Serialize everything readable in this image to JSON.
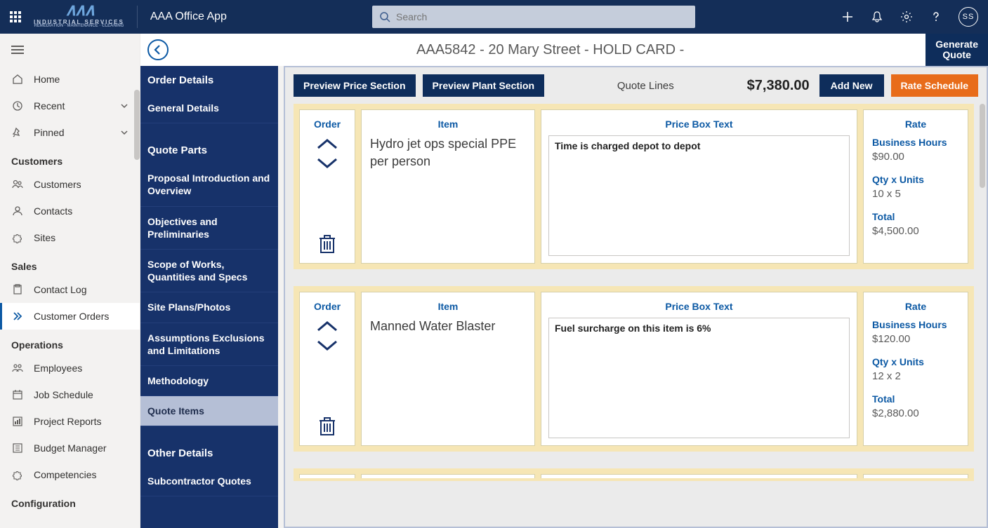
{
  "topbar": {
    "logo_main": "AAA",
    "logo_line1": "INDUSTRIAL SERVICES",
    "logo_line2": "REMEDIATION · MAINTENANCE · CLEANING",
    "app_name": "AAA Office App",
    "search_placeholder": "Search",
    "avatar_initials": "SS"
  },
  "breadbar": {
    "title": "AAA5842 - 20 Mary Street - HOLD CARD -",
    "generate_btn_l1": "Generate",
    "generate_btn_l2": "Quote"
  },
  "leftnav": {
    "home": "Home",
    "recent": "Recent",
    "pinned": "Pinned",
    "sections": {
      "customers": "Customers",
      "sales": "Sales",
      "operations": "Operations",
      "configuration": "Configuration"
    },
    "items": {
      "customers": "Customers",
      "contacts": "Contacts",
      "sites": "Sites",
      "contact_log": "Contact Log",
      "customer_orders": "Customer Orders",
      "employees": "Employees",
      "job_schedule": "Job Schedule",
      "project_reports": "Project Reports",
      "budget_manager": "Budget Manager",
      "competencies": "Competencies"
    }
  },
  "secnav": {
    "order_details": "Order Details",
    "general_details": "General Details",
    "quote_parts": "Quote Parts",
    "proposal": "Proposal Introduction and Overview",
    "objectives": "Objectives and Preliminaries",
    "scope": "Scope of Works, Quantities and Specs",
    "site_plans": "Site Plans/Photos",
    "assumptions": "Assumptions Exclusions and Limitations",
    "methodology": "Methodology",
    "quote_items": "Quote Items",
    "other_details": "Other Details",
    "subcontractor": "Subcontractor Quotes"
  },
  "toolbar": {
    "preview_price": "Preview Price Section",
    "preview_plant": "Preview Plant Section",
    "quote_lines": "Quote Lines",
    "total": "$7,380.00",
    "add_new": "Add New",
    "rate_schedule": "Rate Schedule"
  },
  "columns": {
    "order": "Order",
    "item": "Item",
    "price_box": "Price Box Text",
    "rate": "Rate"
  },
  "rate_labels": {
    "business_hours": "Business Hours",
    "qty_units": "Qty x Units",
    "total": "Total"
  },
  "lines": [
    {
      "item": "Hydro jet ops special PPE per person",
      "price_text": "Time is charged depot to depot",
      "rate_value": "$90.00",
      "qty_units": "10 x 5",
      "total": "$4,500.00"
    },
    {
      "item": "Manned Water Blaster",
      "price_text": "Fuel surcharge on this item is 6%",
      "rate_value": "$120.00",
      "qty_units": "12 x 2",
      "total": "$2,880.00"
    }
  ]
}
